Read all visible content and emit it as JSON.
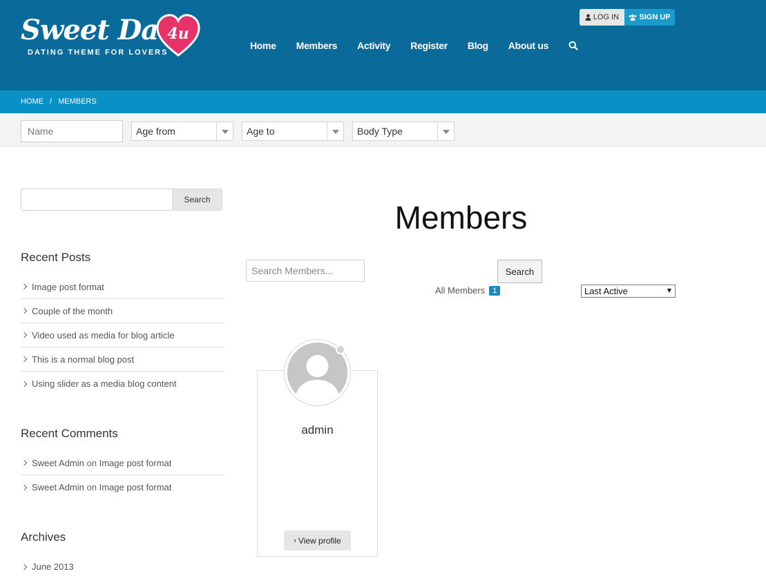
{
  "header": {
    "logo_script": "Sweet Date",
    "logo_badge": "4u",
    "logo_tagline": "DATING THEME FOR LOVERS",
    "nav": [
      "Home",
      "Members",
      "Activity",
      "Register",
      "Blog",
      "About us"
    ],
    "login_label": "LOG IN",
    "signup_label": "SIGN UP",
    "colors": {
      "header_bg": "#0a6b9b",
      "accent": "#0791c7",
      "heart": "#e8336a"
    }
  },
  "breadcrumb": [
    "HOME",
    "/",
    "MEMBERS"
  ],
  "filters": {
    "name_placeholder": "Name",
    "age_from": "Age from",
    "age_to": "Age to",
    "body_type": "Body Type"
  },
  "sidebar": {
    "search_button": "Search",
    "recent_posts_title": "Recent Posts",
    "recent_posts": [
      "Image post format",
      "Couple of the month",
      "Video used as media for blog article",
      "This is a normal blog post",
      "Using slider as a media blog content"
    ],
    "recent_comments_title": "Recent Comments",
    "recent_comments": [
      {
        "author": "Sweet Admin",
        "on": "on",
        "post": "Image post format"
      },
      {
        "author": "Sweet Admin",
        "on": "on",
        "post": "Image post format"
      }
    ],
    "archives_title": "Archives",
    "archives": [
      "June 2013"
    ]
  },
  "main": {
    "title": "Members",
    "search_placeholder": "Search Members...",
    "search_button": "Search",
    "all_members_label": "All Members",
    "member_count": "1",
    "order_by": "Last Active",
    "members": [
      {
        "name": "admin",
        "view_label": "View profile"
      }
    ]
  }
}
